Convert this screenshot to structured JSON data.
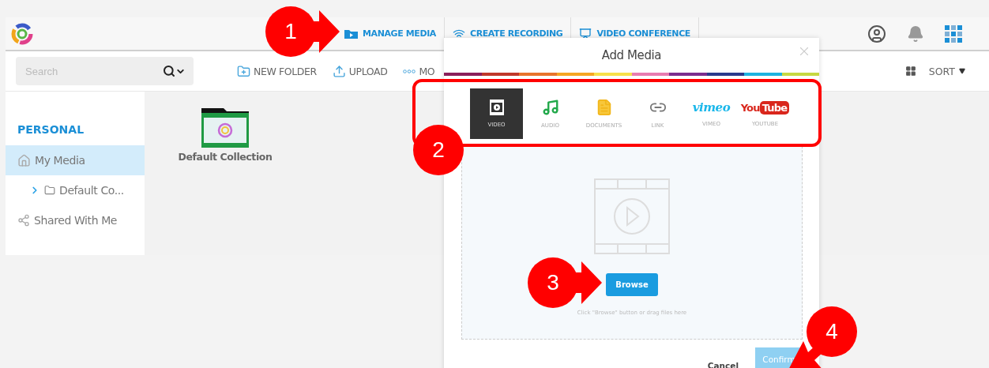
{
  "header": {
    "nav": [
      {
        "kind": "media",
        "label": "MANAGE MEDIA"
      },
      {
        "kind": "recording",
        "label": "CREATE RECORDING"
      },
      {
        "kind": "conference",
        "label": "VIDEO CONFERENCE"
      }
    ]
  },
  "toolbar": {
    "search": {
      "placeholder": "Search"
    },
    "actions": [
      {
        "kind": "new-folder",
        "label": "NEW FOLDER"
      },
      {
        "kind": "upload",
        "label": "UPLOAD"
      },
      {
        "kind": "more",
        "label": "MO"
      }
    ],
    "sort": "SORT"
  },
  "sidebar": {
    "heading": "PERSONAL",
    "items": [
      {
        "kind": "home",
        "label": "My Media",
        "selected": true,
        "children": [
          {
            "kind": "folder",
            "label": "Default Co...",
            "selected": false,
            "expanded": false
          }
        ]
      },
      {
        "kind": "shared",
        "label": "Shared With Me",
        "selected": false
      }
    ]
  },
  "collections": [
    {
      "label": "Default Collection"
    }
  ],
  "modal": {
    "title": "Add Media",
    "tabs": [
      {
        "kind": "video",
        "label": "VIDEO",
        "selected": true
      },
      {
        "kind": "audio",
        "label": "AUDIO",
        "selected": false
      },
      {
        "kind": "documents",
        "label": "DOCUMENTS",
        "selected": false
      },
      {
        "kind": "link",
        "label": "LINK",
        "selected": false
      },
      {
        "kind": "vimeo",
        "label": "VIMEO",
        "selected": false,
        "logo": [
          "vimeo"
        ]
      },
      {
        "kind": "youtube",
        "label": "YOUTUBE",
        "selected": false,
        "logo": [
          "You",
          "Tube"
        ]
      }
    ],
    "browse": "Browse",
    "hint": "Click \"Browse\" button or drag files here",
    "cancel": "Cancel",
    "confirm": "Confirm"
  },
  "callouts": [
    {
      "label": "1",
      "kind": "arrow-right"
    },
    {
      "label": "2",
      "kind": "frame"
    },
    {
      "label": "3",
      "kind": "arrow-right"
    },
    {
      "label": "4",
      "kind": "arrow-down-left"
    }
  ]
}
